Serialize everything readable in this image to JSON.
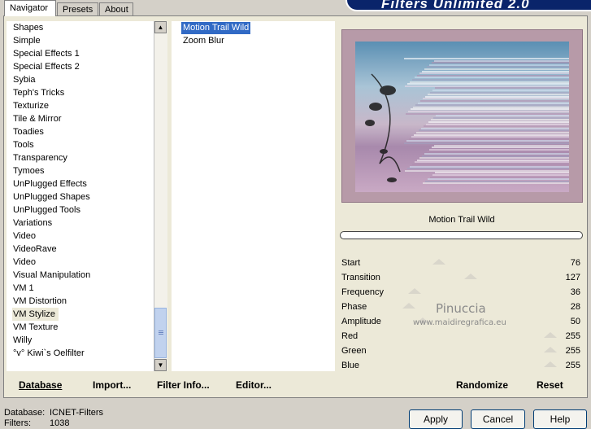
{
  "tabs": [
    {
      "label": "Navigator",
      "active": true
    },
    {
      "label": "Presets",
      "active": false
    },
    {
      "label": "About",
      "active": false
    }
  ],
  "banner": {
    "title": "Filters Unlimited 2.0"
  },
  "categories": [
    "Shapes",
    "Simple",
    "Special Effects 1",
    "Special Effects 2",
    "Sybia",
    "Teph's Tricks",
    "Texturize",
    "Tile & Mirror",
    "Toadies",
    "Tools",
    "Transparency",
    "Tymoes",
    "UnPlugged Effects",
    "UnPlugged Shapes",
    "UnPlugged Tools",
    "Variations",
    "Video",
    "VideoRave",
    "Video",
    "Visual Manipulation",
    "VM 1",
    "VM Distortion",
    "VM Stylize",
    "VM Texture",
    "Willy",
    "°v° Kiwi`s Oelfilter"
  ],
  "selected_category": "VM Stylize",
  "filters": [
    "Motion Trail Wild",
    "Zoom Blur"
  ],
  "selected_filter": "Motion Trail Wild",
  "left_buttons": [
    {
      "label": "Database"
    },
    {
      "label": "Import..."
    },
    {
      "label": "Filter Info..."
    },
    {
      "label": "Editor..."
    }
  ],
  "preview_filter_name": "Motion Trail Wild",
  "parameters": [
    {
      "name": "Start",
      "value": 76
    },
    {
      "name": "Transition",
      "value": 127
    },
    {
      "name": "Frequency",
      "value": 36
    },
    {
      "name": "Phase",
      "value": 28
    },
    {
      "name": "Amplitude",
      "value": 50
    },
    {
      "name": "Red",
      "value": 255
    },
    {
      "name": "Green",
      "value": 255
    },
    {
      "name": "Blue",
      "value": 255
    }
  ],
  "param_buttons": {
    "randomize": "Randomize",
    "reset": "Reset"
  },
  "watermark": {
    "line1": "Pinuccia",
    "line2": "www.maidiregrafica.eu"
  },
  "footer": {
    "database_label": "Database:",
    "database_value": "ICNET-Filters",
    "filters_label": "Filters:",
    "filters_value": "1038"
  },
  "dialog_buttons": {
    "apply": "Apply",
    "cancel": "Cancel",
    "help": "Help"
  },
  "colors": {
    "selection": "#316ac5",
    "banner": "#0a246a",
    "frame": "#ece9d8",
    "dialog": "#d4d0c8"
  }
}
